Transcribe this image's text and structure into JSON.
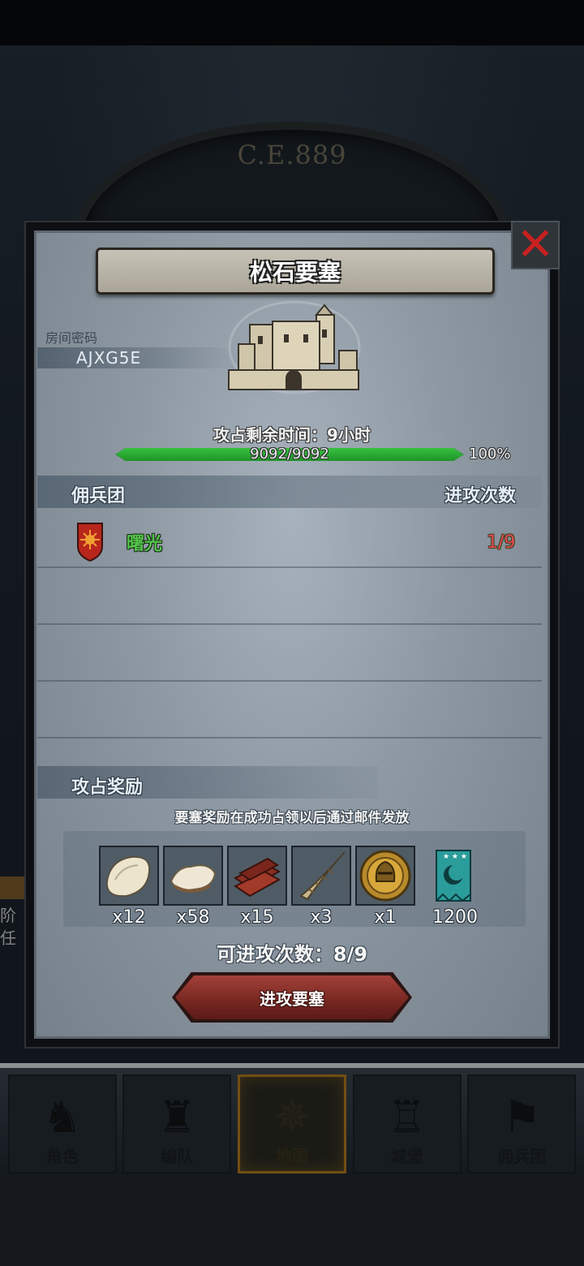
{
  "background": {
    "year_label": "C.E.889",
    "side_texts": [
      "阶",
      "任"
    ]
  },
  "bottom_nav": {
    "items": [
      {
        "label": "角色",
        "icon": "knight-icon",
        "active": false
      },
      {
        "label": "编队",
        "icon": "squad-icon",
        "active": false
      },
      {
        "label": "地图",
        "icon": "compass-icon",
        "active": true
      },
      {
        "label": "城堡",
        "icon": "castle-icon",
        "active": false
      },
      {
        "label": "佣兵团",
        "icon": "flag-icon",
        "active": false
      }
    ]
  },
  "dialog": {
    "title": "松石要塞",
    "room_code_label": "房间密码",
    "room_code": "AJXG5E",
    "time_remaining": "攻占剩余时间：9小时",
    "hp_text": "9092/9092",
    "hp_fraction": 1.0,
    "hp_percent": "100%",
    "header_left": "佣兵团",
    "header_right": "进攻次数",
    "guilds": [
      {
        "name": "曙光",
        "count": "1/9",
        "shield_color": "#b8261c"
      }
    ],
    "reward_header": "攻占奖励",
    "reward_note": "要塞奖励在成功占领以后通过邮件发放",
    "rewards": [
      {
        "icon": "fur-pelt-icon",
        "qty": "x12"
      },
      {
        "icon": "wool-icon",
        "qty": "x58"
      },
      {
        "icon": "wood-planks-icon",
        "qty": "x15"
      },
      {
        "icon": "horn-icon",
        "qty": "x3"
      },
      {
        "icon": "knight-helmet-medal-icon",
        "qty": "x1"
      },
      {
        "icon": "guild-banner-icon",
        "qty": "1200"
      }
    ],
    "attacks_left": "可进攻次数：8/9",
    "attack_button": "进攻要塞"
  },
  "colors": {
    "progress_green": "#2fb33a",
    "guild_name_green": "#52c24a",
    "count_red": "#e04a52",
    "close_red": "#c82020",
    "button_red": "#7a2822"
  }
}
